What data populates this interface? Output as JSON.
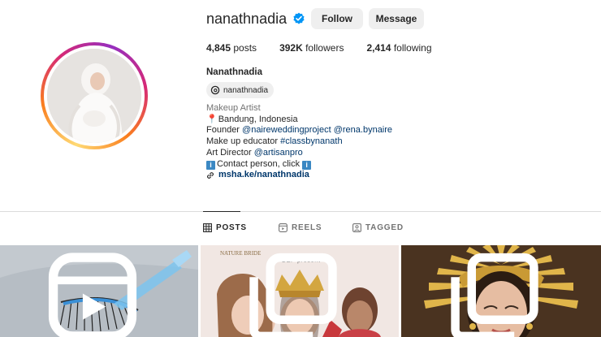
{
  "profile": {
    "username": "nanathnadia",
    "verified": true,
    "follow_label": "Follow",
    "message_label": "Message",
    "display_name": "Nanathnadia",
    "threads_handle": "nanathnadia"
  },
  "stats": {
    "posts_count": "4,845",
    "posts_label": "posts",
    "followers_count": "392K",
    "followers_label": "followers",
    "following_count": "2,414",
    "following_label": "following"
  },
  "bio": {
    "category": "Makeup Artist",
    "location": "Bandung, Indonesia",
    "founder_prefix": "Founder ",
    "founder_tag1": "@naireweddingproject",
    "founder_tag2": "@rena.bynaire",
    "educator_prefix": "Make up educator ",
    "educator_tag": "#classbynanath",
    "director_prefix": "Art Director ",
    "director_tag": "@artisanpro",
    "contact_text": "Contact person, click ",
    "info_glyph": "i",
    "link": "msha.ke/nanathnadia"
  },
  "tabs": [
    {
      "label": "POSTS",
      "active": true,
      "icon": "grid-icon"
    },
    {
      "label": "REELS",
      "active": false,
      "icon": "reels-icon"
    },
    {
      "label": "TAGGED",
      "active": false,
      "icon": "tagged-icon"
    }
  ],
  "posts": [
    {
      "type": "reel",
      "icon": "reel-badge-icon"
    },
    {
      "type": "carousel",
      "icon": "carousel-badge-icon",
      "brand_text": "NATURE BRIDE",
      "overlay_text": "BEP present"
    },
    {
      "type": "carousel",
      "icon": "carousel-badge-icon"
    }
  ],
  "colors": {
    "accent_blue": "#0095f6",
    "link_blue": "#00376b",
    "button_gray": "#efefef",
    "muted_text": "#737373"
  }
}
